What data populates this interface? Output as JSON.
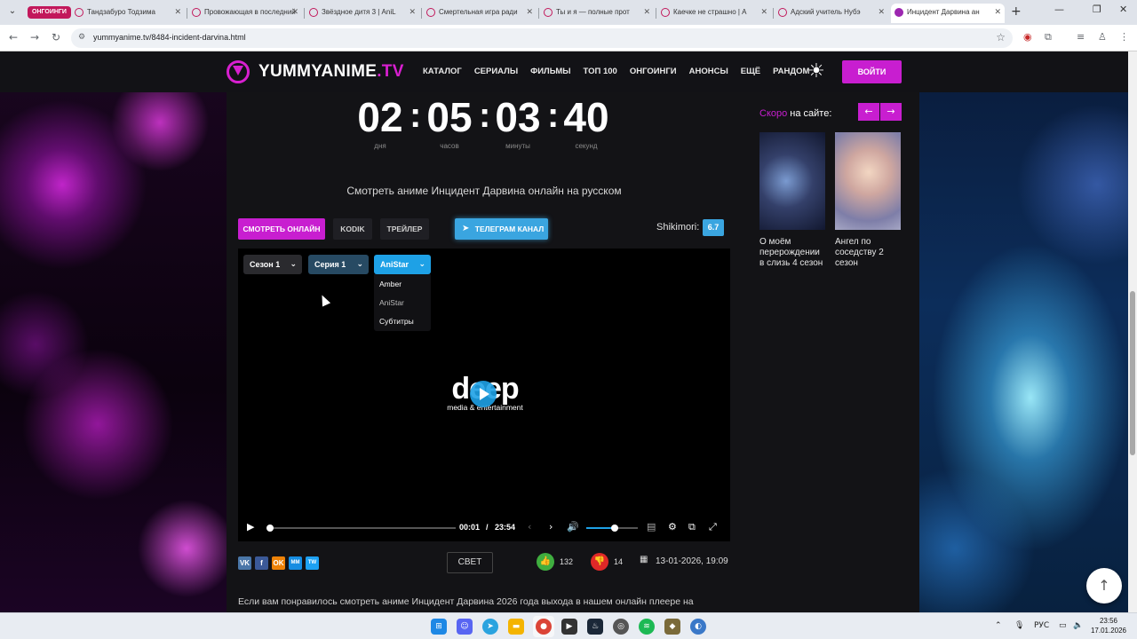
{
  "browser": {
    "tab_group_label": "ОНГОИНГИ",
    "tabs": [
      {
        "title": "Тандзабуро Тодзима"
      },
      {
        "title": "Провожающая в последний"
      },
      {
        "title": "Звёздное дитя 3 | AniL"
      },
      {
        "title": "Смертельная игра ради"
      },
      {
        "title": "Ты и я — полные прот"
      },
      {
        "title": "Каечке не страшно | А"
      },
      {
        "title": "Адский учитель Нубэ"
      },
      {
        "title": "Инцидент Дарвина ан"
      }
    ],
    "url": "yummyanime.tv/8484-incident-darvina.html"
  },
  "site": {
    "logo_main": "YUMMYANIME",
    "logo_tld": ".TV",
    "nav": [
      "КАТАЛОГ",
      "СЕРИАЛЫ",
      "ФИЛЬМЫ",
      "ТОП 100",
      "ОНГОИНГИ",
      "АНОНСЫ",
      "ЕЩЁ",
      "РАНДОМ"
    ],
    "login": "ВОЙТИ",
    "accent": "#c81ed0"
  },
  "countdown": {
    "days": "02",
    "hours": "05",
    "minutes": "03",
    "seconds": "40",
    "days_label": "дня",
    "hours_label": "часов",
    "minutes_label": "минуты",
    "seconds_label": "секунд"
  },
  "watch_title": "Смотреть аниме Инцидент Дарвина онлайн на русском",
  "buttons": {
    "watch": "СМОТРЕТЬ ОНЛАЙН",
    "kodik": "KODIK",
    "trailer": "ТРЕЙЛЕР",
    "telegram": "ТЕЛЕГРАМ КАНАЛ",
    "shikimori_label": "Shikimori:",
    "shikimori_score": "6.7"
  },
  "player": {
    "season": "Сезон 1",
    "episode": "Серия 1",
    "voice": "AniStar",
    "voice_options": [
      "Amber",
      "AniStar",
      "Субтитры"
    ],
    "logo_word": "deep",
    "logo_sub": "media & entertainment",
    "time_current": "00:01",
    "time_separator": "/",
    "time_total": "23:54",
    "progress": 0.0,
    "volume": 0.55
  },
  "actions": {
    "share": [
      "VK",
      "f",
      "OK",
      "MM",
      "TW"
    ],
    "svet": "СВЕТ",
    "likes": "132",
    "dislikes": "14",
    "date": "13-01-2026, 19:09"
  },
  "description": "Если вам понравилось смотреть аниме Инцидент Дарвина 2026 года выхода в нашем онлайн плеере на",
  "sidebar": {
    "soon_highlight": "Скоро",
    "soon_rest": " на сайте:",
    "items": [
      {
        "title": "О моём перерождении в слизь 4 сезон"
      },
      {
        "title": "Ангел по соседству 2 сезон"
      }
    ]
  },
  "taskbar": {
    "lang": "РУС",
    "time": "23:56",
    "date": "17.01.2026"
  }
}
